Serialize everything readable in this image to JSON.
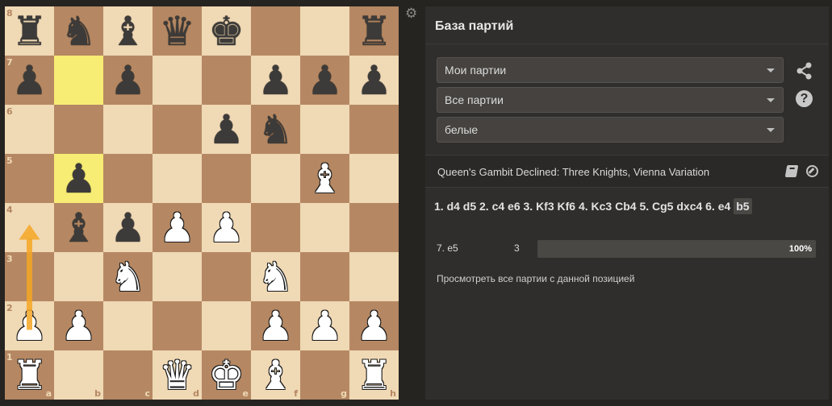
{
  "board": {
    "files": [
      "a",
      "b",
      "c",
      "d",
      "e",
      "f",
      "g",
      "h"
    ],
    "ranks": [
      "8",
      "7",
      "6",
      "5",
      "4",
      "3",
      "2",
      "1"
    ],
    "highlighted_squares": [
      "b7",
      "b5"
    ],
    "last_move_arrow": {
      "from": "a2",
      "to": "a4",
      "color": "#f5a623"
    },
    "pieces": {
      "a8": "bR",
      "b8": "bN",
      "c8": "bB",
      "d8": "bQ",
      "e8": "bK",
      "h8": "bR",
      "a7": "bP",
      "c7": "bP",
      "f7": "bP",
      "g7": "bP",
      "h7": "bP",
      "e6": "bP",
      "f6": "bN",
      "b5": "bP",
      "g5": "wB",
      "b4": "bB",
      "c4": "bP",
      "d4": "wP",
      "e4": "wP",
      "c3": "wN",
      "f3": "wN",
      "a2": "wP",
      "b2": "wP",
      "f2": "wP",
      "g2": "wP",
      "h2": "wP",
      "a1": "wR",
      "d1": "wQ",
      "e1": "wK",
      "f1": "wB",
      "h1": "wR"
    }
  },
  "settings_icon": "gear-icon",
  "panel": {
    "title": "База партий",
    "selects": [
      {
        "value": "Мои партии"
      },
      {
        "value": "Все партии"
      },
      {
        "value": "белые"
      }
    ],
    "share_icon": "share-icon",
    "help_label": "?",
    "opening": "Queen's Gambit Declined: Three Knights, Vienna Variation",
    "moves_text": "1. d4 d5 2. c4 e6 3. Kf3 Kf6 4. Kc3 Cb4 5. Cg5 dxc4 6. e4",
    "last_move": "b5",
    "stats": [
      {
        "move": "7. e5",
        "count": "3",
        "percent_label": "100%",
        "percent": 100
      }
    ],
    "view_all": "Просмотреть все партии с данной позицией"
  },
  "colors": {
    "light_square": "#f0d9b5",
    "dark_square": "#b58863",
    "highlight": "#f7ec74",
    "panel_bg": "#302e2c",
    "arrow": "#f5a623"
  }
}
